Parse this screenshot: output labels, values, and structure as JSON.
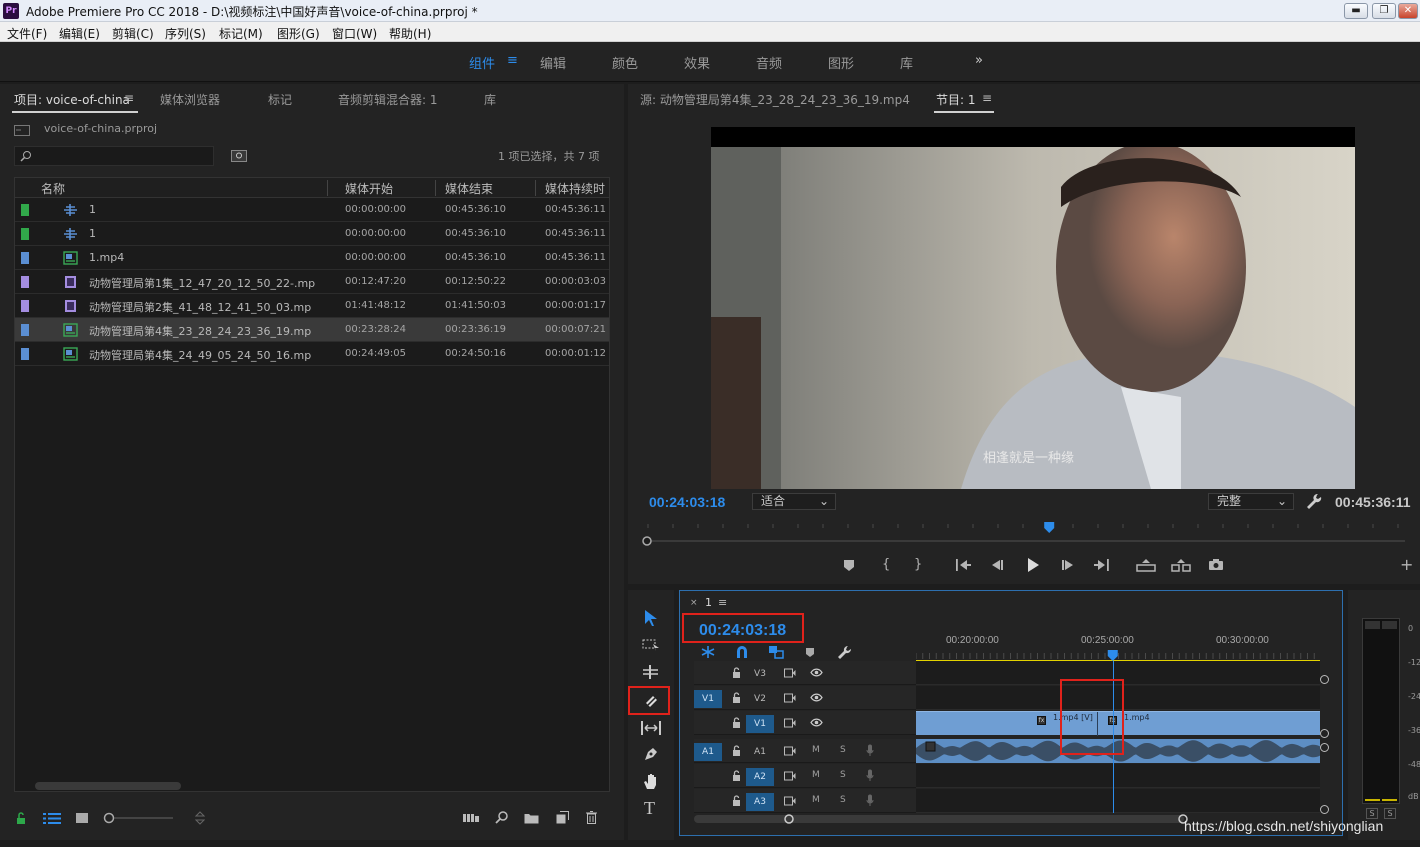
{
  "titlebar": {
    "logo": "Pr",
    "title": "Adobe Premiere Pro CC 2018 - D:\\视频标注\\中国好声音\\voice-of-china.prproj *",
    "minimize": "▬",
    "restore": "❐",
    "close": "✕"
  },
  "menu": [
    "文件(F)",
    "编辑(E)",
    "剪辑(C)",
    "序列(S)",
    "标记(M)",
    "图形(G)",
    "窗口(W)",
    "帮助(H)"
  ],
  "workspaces": {
    "items": [
      "组件",
      "编辑",
      "颜色",
      "效果",
      "音频",
      "图形",
      "库"
    ],
    "active": "组件",
    "overflow": "»"
  },
  "project": {
    "tabs": [
      "项目: voice-of-china",
      "媒体浏览器",
      "标记",
      "音频剪辑混合器: 1",
      "库"
    ],
    "file": "voice-of-china.prproj",
    "search_placeholder": "",
    "selection_status": "1 项已选择，共 7 项",
    "columns": [
      "名称",
      "媒体开始",
      "媒体结束",
      "媒体持续时"
    ],
    "rows": [
      {
        "name": "1",
        "start": "00:00:00:00",
        "end": "00:45:36:10",
        "dur": "00:45:36:11",
        "color": "#31a84a",
        "kind": "seq"
      },
      {
        "name": "1",
        "start": "00:00:00:00",
        "end": "00:45:36:10",
        "dur": "00:45:36:11",
        "color": "#31a84a",
        "kind": "seq"
      },
      {
        "name": "1.mp4",
        "start": "00:00:00:00",
        "end": "00:45:36:10",
        "dur": "00:45:36:11",
        "color": "#5b8fd3",
        "kind": "av"
      },
      {
        "name": "动物管理局第1集_12_47_20_12_50_22-.mp",
        "start": "00:12:47:20",
        "end": "00:12:50:22",
        "dur": "00:00:03:03",
        "color": "#a48de0",
        "kind": "v"
      },
      {
        "name": "动物管理局第2集_41_48_12_41_50_03.mp",
        "start": "01:41:48:12",
        "end": "01:41:50:03",
        "dur": "00:00:01:17",
        "color": "#a48de0",
        "kind": "v"
      },
      {
        "name": "动物管理局第4集_23_28_24_23_36_19.mp",
        "start": "00:23:28:24",
        "end": "00:23:36:19",
        "dur": "00:00:07:21",
        "color": "#5b8fd3",
        "kind": "av"
      },
      {
        "name": "动物管理局第4集_24_49_05_24_50_16.mp",
        "start": "00:24:49:05",
        "end": "00:24:50:16",
        "dur": "00:00:01:12",
        "color": "#5b8fd3",
        "kind": "av"
      }
    ],
    "selected_row": 5
  },
  "monitor": {
    "source_tab": "源: 动物管理局第4集_23_28_24_23_36_19.mp4",
    "program_tab": "节目: 1",
    "subtitle": "相逢就是一种缘",
    "timecode": "00:24:03:18",
    "fit": "适合",
    "quality": "完整",
    "duration": "00:45:36:11",
    "playhead_fraction": 0.53
  },
  "timeline": {
    "seq_name": "1",
    "timecode": "00:24:03:18",
    "ruler": [
      "00:20:00:00",
      "00:25:00:00",
      "00:30:00:00"
    ],
    "playhead_fraction": 0.487,
    "video_tracks": [
      {
        "name": "V3",
        "src": ""
      },
      {
        "name": "V2",
        "src": "V1"
      },
      {
        "name": "V1",
        "src": ""
      }
    ],
    "audio_tracks": [
      {
        "name": "A1",
        "src": "A1"
      },
      {
        "name": "A2",
        "src": ""
      },
      {
        "name": "A3",
        "src": ""
      }
    ],
    "clip_labels": [
      "1.mp4 [V]",
      "1.mp4"
    ],
    "track_btn_m": "M",
    "track_btn_s": "S"
  },
  "meters": {
    "scale": [
      "0",
      "-12",
      "-24",
      "-36",
      "-48",
      "dB"
    ],
    "solo": "S"
  },
  "watermark": "https://blog.csdn.net/shiyonglian"
}
